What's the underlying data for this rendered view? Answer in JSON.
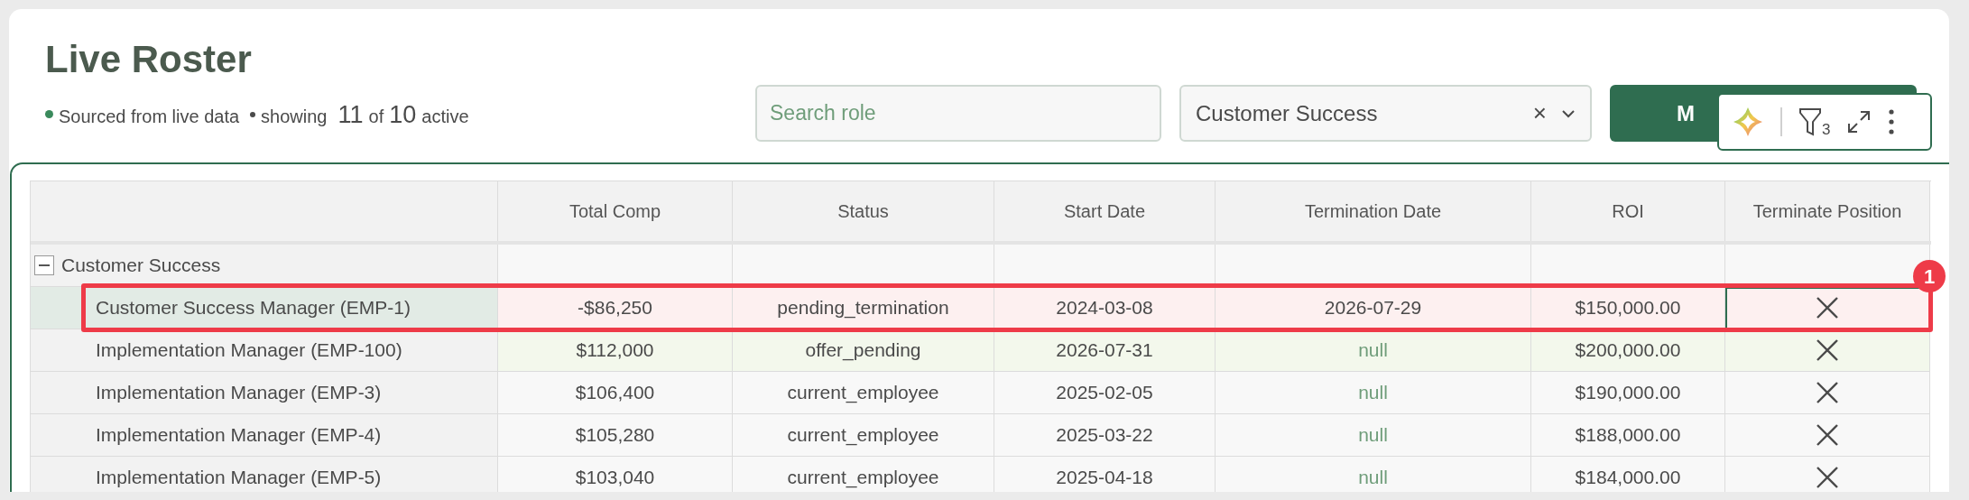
{
  "title": "Live Roster",
  "subtitle": {
    "source": "Sourced from live data",
    "showing": "showing",
    "shown": "11",
    "of": "of",
    "total": "10",
    "suffix": "active"
  },
  "search": {
    "placeholder": "Search role"
  },
  "department_select": {
    "value": "Customer Success",
    "clear": "×"
  },
  "action_button": {
    "label": "M"
  },
  "toolbar": {
    "filter_count": "3"
  },
  "table": {
    "columns": [
      "",
      "Total Comp",
      "Status",
      "Start Date",
      "Termination Date",
      "ROI",
      "Terminate Position"
    ],
    "group": {
      "label": "Customer Success",
      "expanded": true
    },
    "rows": [
      {
        "name": "Customer Success Manager (EMP-1)",
        "kind": "pending",
        "selected": true,
        "total_comp": "-$86,250",
        "status": "pending_termination",
        "start_date": "2024-03-08",
        "termination_date": {
          "text": "2026-07-29",
          "muted": false
        },
        "roi": "$150,000.00"
      },
      {
        "name": "Implementation Manager (EMP-100)",
        "kind": "offer",
        "selected": false,
        "total_comp": "$112,000",
        "status": "offer_pending",
        "start_date": "2026-07-31",
        "termination_date": {
          "text": "null",
          "muted": true
        },
        "roi": "$200,000.00"
      },
      {
        "name": "Implementation Manager (EMP-3)",
        "kind": "normal",
        "selected": false,
        "total_comp": "$106,400",
        "status": "current_employee",
        "start_date": "2025-02-05",
        "termination_date": {
          "text": "null",
          "muted": true
        },
        "roi": "$190,000.00"
      },
      {
        "name": "Implementation Manager (EMP-4)",
        "kind": "normal",
        "selected": false,
        "total_comp": "$105,280",
        "status": "current_employee",
        "start_date": "2025-03-22",
        "termination_date": {
          "text": "null",
          "muted": true
        },
        "roi": "$188,000.00"
      },
      {
        "name": "Implementation Manager (EMP-5)",
        "kind": "normal",
        "selected": false,
        "total_comp": "$103,040",
        "status": "current_employee",
        "start_date": "2025-04-18",
        "termination_date": {
          "text": "null",
          "muted": true
        },
        "roi": "$184,000.00"
      }
    ]
  },
  "annotation": {
    "number": "1"
  }
}
